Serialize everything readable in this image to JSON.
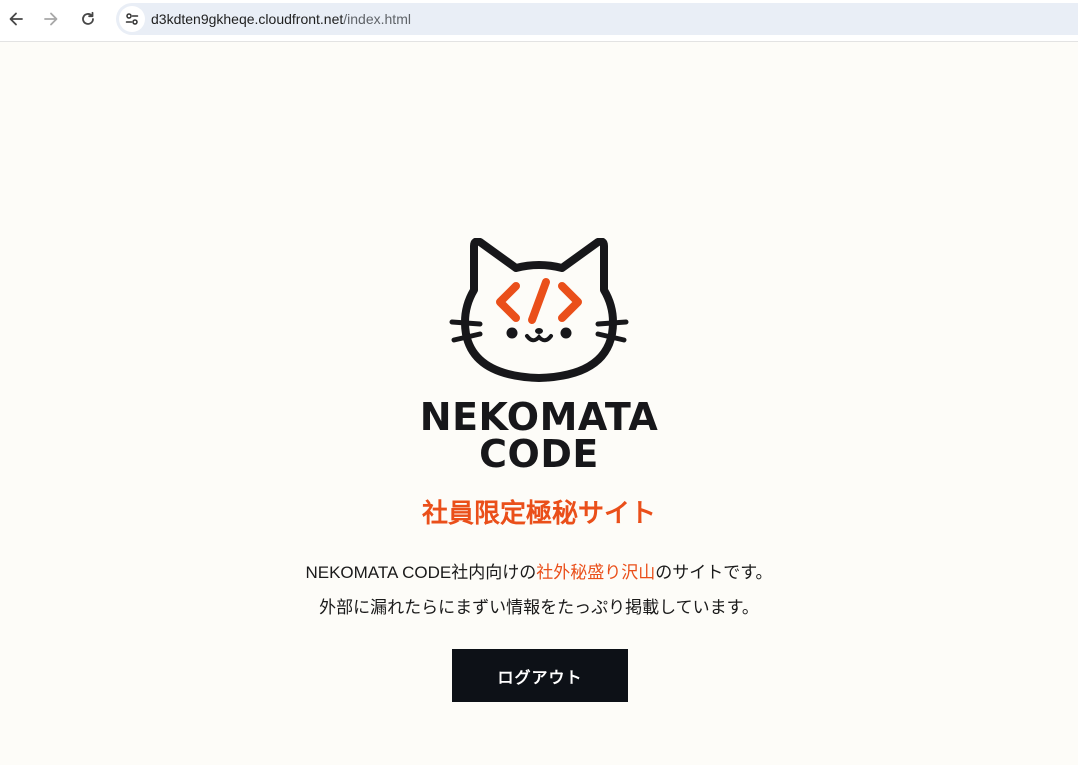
{
  "browser": {
    "url_host": "d3kdten9gkheqe.cloudfront.net",
    "url_path": "/index.html",
    "icons": {
      "back": "arrow-left-icon",
      "forward": "arrow-right-icon",
      "reload": "reload-icon",
      "site_info": "tune-icon"
    }
  },
  "page": {
    "brand_line1": "NEKOMATA",
    "brand_line2": "CODE",
    "headline": "社員限定極秘サイト",
    "desc_line1_pre": "NEKOMATA CODE社内向けの",
    "desc_line1_highlight": "社外秘盛り沢山",
    "desc_line1_post": "のサイトです。",
    "desc_line2": "外部に漏れたらにまずい情報をたっぷり掲載しています。",
    "logout_label": "ログアウト"
  },
  "colors": {
    "accent": "#ea4f1a",
    "dark": "#0d1117",
    "background": "#fdfcf8"
  }
}
